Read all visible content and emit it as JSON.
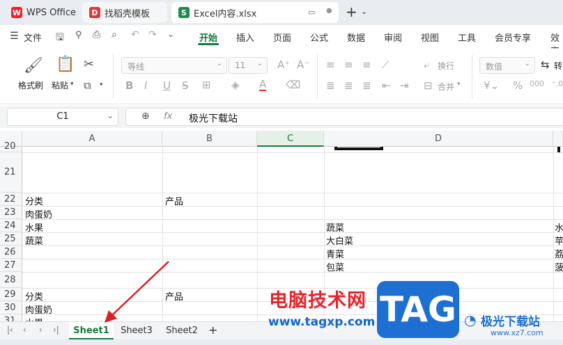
{
  "tabs": [
    {
      "label": "WPS Office",
      "icon": "wps-logo-icon"
    },
    {
      "label": "找稻壳模板",
      "icon": "docer-logo-icon"
    },
    {
      "label": "Excel内容.xlsx",
      "icon": "sheet-logo-icon"
    }
  ],
  "menu": {
    "file": "文件",
    "items": [
      "开始",
      "插入",
      "页面",
      "公式",
      "数据",
      "审阅",
      "视图",
      "工具",
      "会员专享",
      "效率"
    ],
    "active": "开始"
  },
  "ribbon": {
    "format_painter": "格式刷",
    "paste": "粘贴",
    "font_name": "等线",
    "font_size": "11",
    "wrap": "换行",
    "merge": "合并",
    "number_format": "数值",
    "convert": "转"
  },
  "formula": {
    "cell_ref": "C1",
    "fx": "fx",
    "value": "极光下载站"
  },
  "grid": {
    "columns": [
      "A",
      "B",
      "C",
      "D"
    ],
    "rows": [
      "20",
      "21",
      "22",
      "23",
      "24",
      "25",
      "26",
      "27",
      "28",
      "29",
      "30",
      "31"
    ],
    "cells": {
      "a22": "分类",
      "b22": "产品",
      "a23": "肉蛋奶",
      "a24": "水果",
      "d24": "蔬菜",
      "e24": "水",
      "a25": "蔬菜",
      "d25": "大白菜",
      "e25": "苹",
      "d26": "青菜",
      "e26": "荔",
      "d27": "包菜",
      "e27": "菠",
      "a29": "分类",
      "b29": "产品",
      "a30": "肉蛋奶",
      "a31": "水果"
    }
  },
  "sheets": [
    "Sheet1",
    "Sheet3",
    "Sheet2"
  ],
  "active_sheet": "Sheet1",
  "watermark": {
    "site": "电脑技术网",
    "url": "www.tagxp.com",
    "badge": "TAG",
    "brand": "极光下载站",
    "brand_url": "www.xz7.com"
  },
  "colors": {
    "accent": "#147a3d",
    "wps_red": "#e8232a",
    "docer_red": "#d93a3a",
    "sheet_green": "#1f8a4c"
  }
}
